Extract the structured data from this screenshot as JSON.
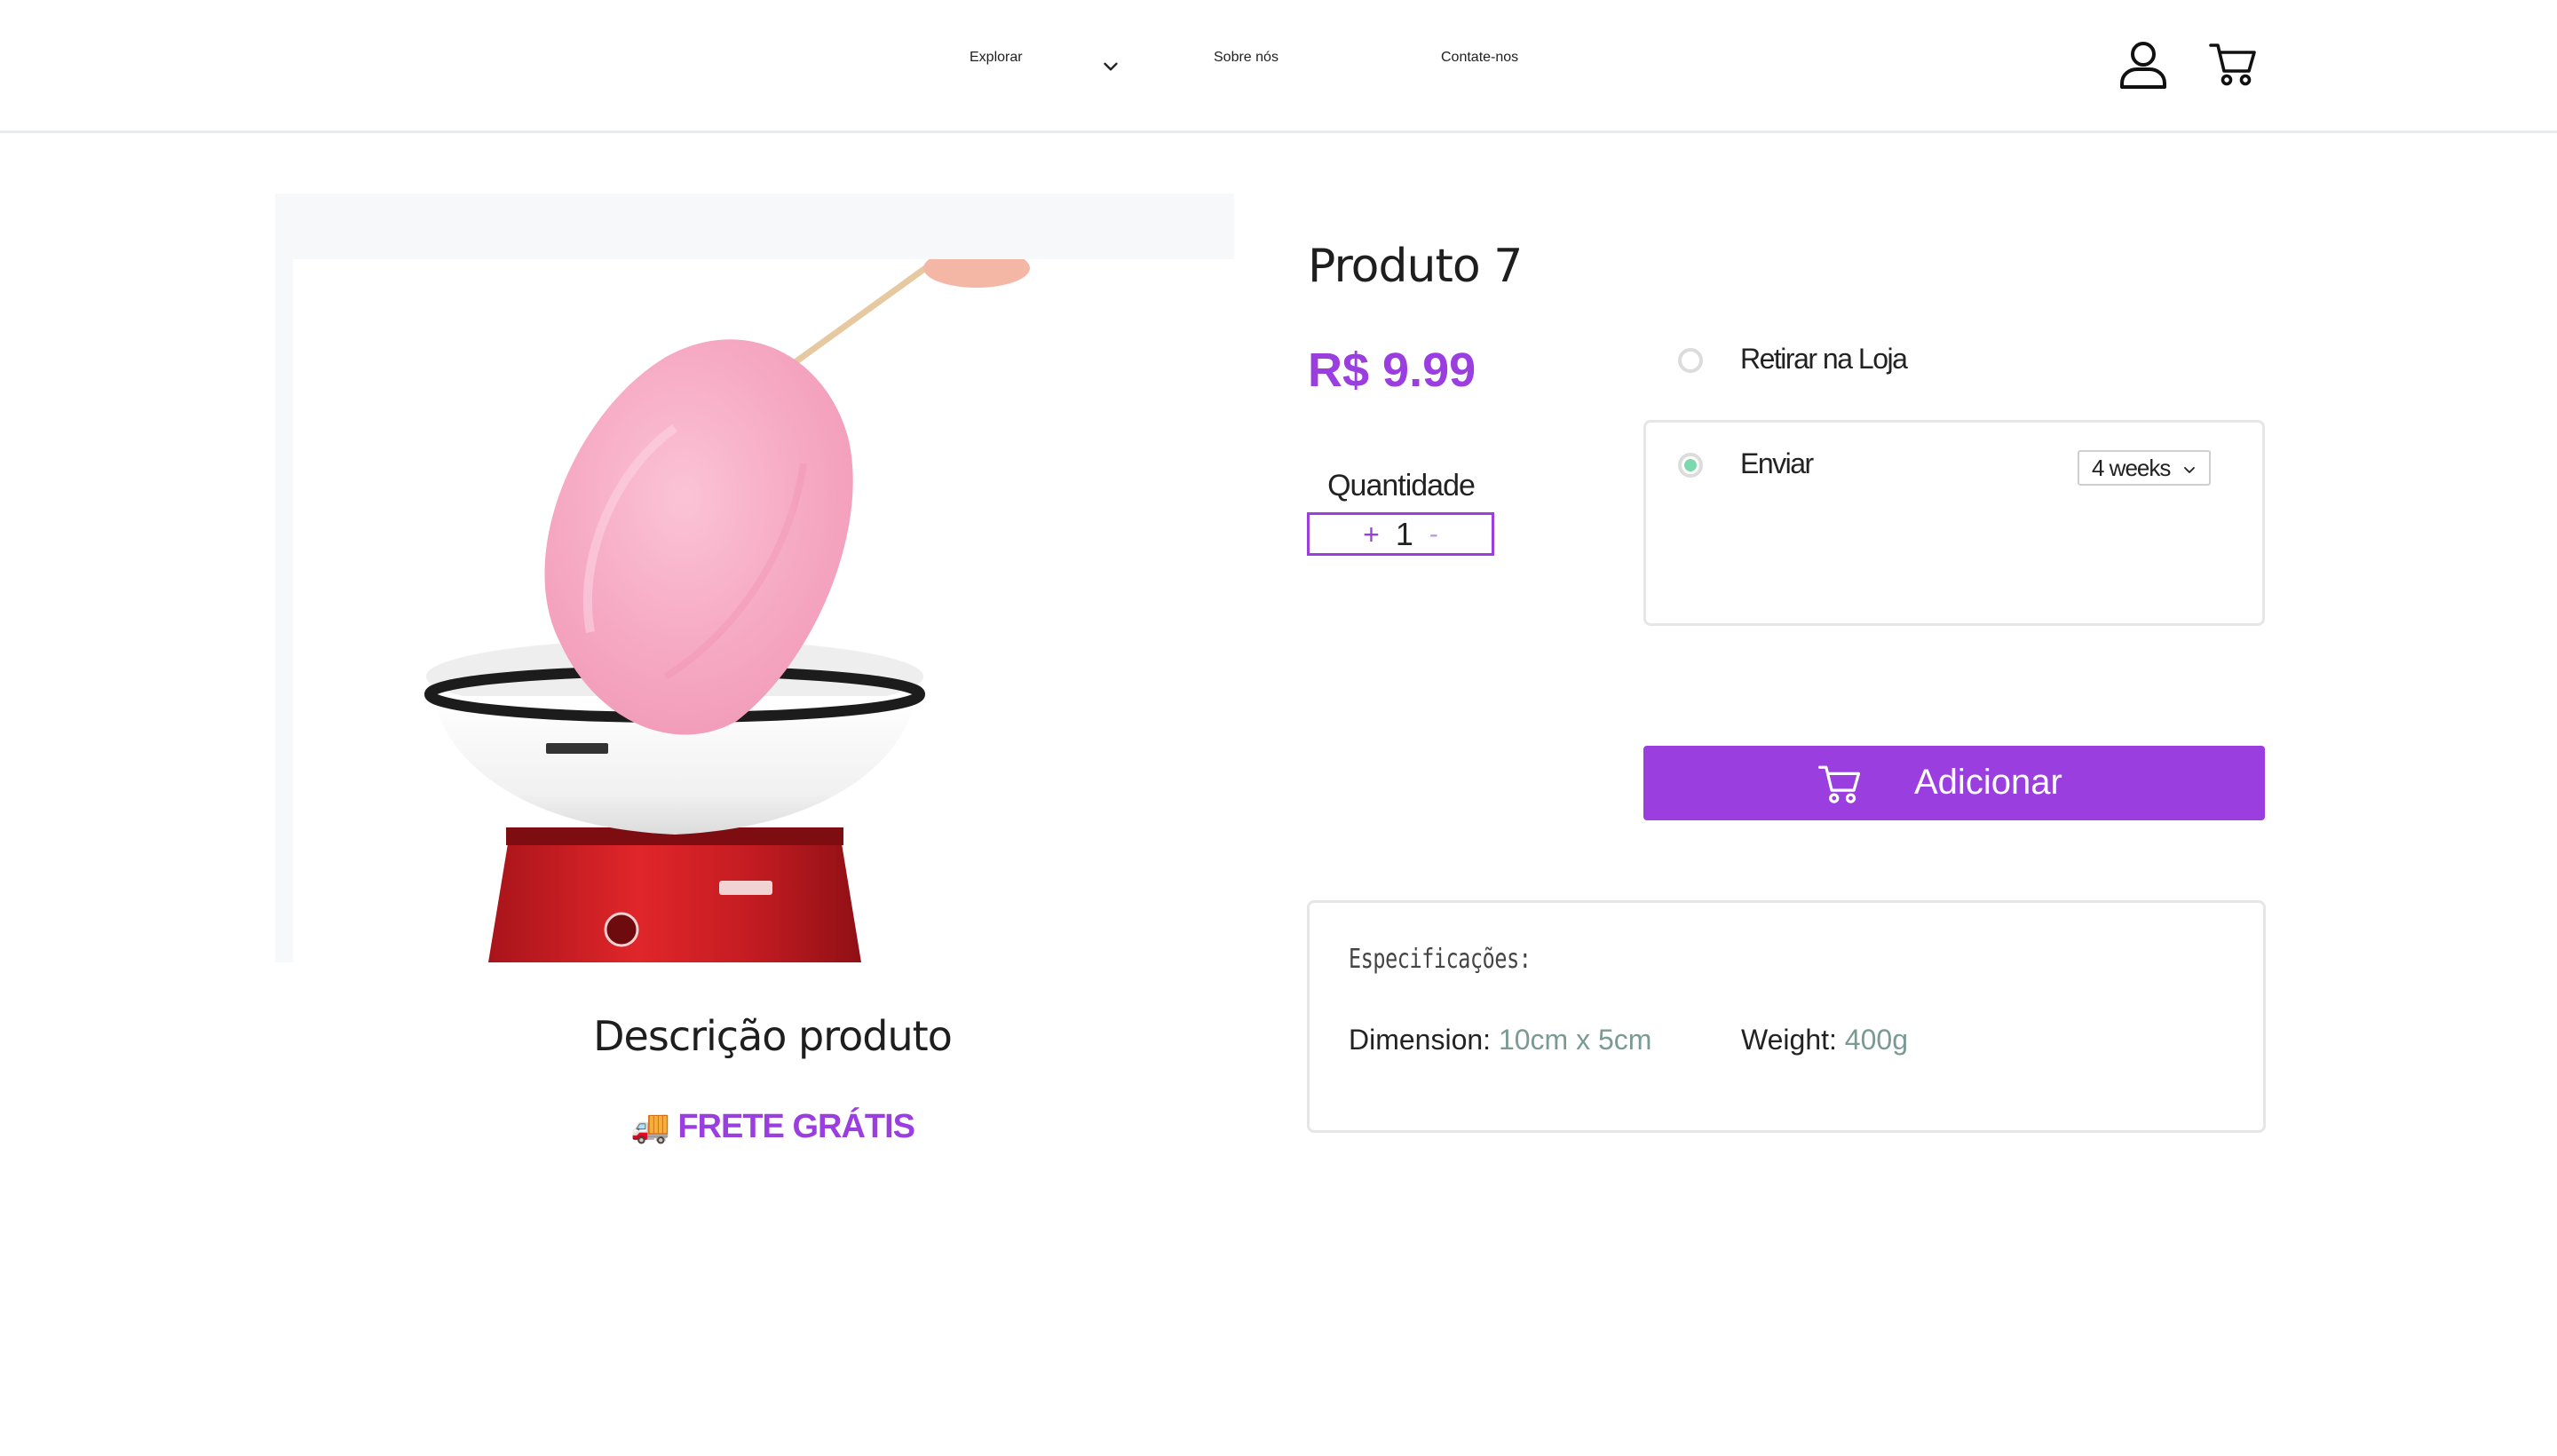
{
  "header": {
    "nav": {
      "explorar": "Explorar",
      "sobre": "Sobre nós",
      "contate": "Contate-nos"
    }
  },
  "product": {
    "title": "Produto 7",
    "price": "R$ 9.99",
    "quantity_label": "Quantidade",
    "quantity_plus": "+",
    "quantity_value": "1",
    "quantity_minus": "-",
    "description_title": "Descrição produto",
    "free_shipping_icon": "🚚",
    "free_shipping": "FRETE GRÁTIS"
  },
  "delivery": {
    "pickup_label": "Retirar na Loja",
    "ship_label": "Enviar",
    "frequency_selected": "4 weeks",
    "selected_option": "Enviar"
  },
  "actions": {
    "add_label": "Adicionar"
  },
  "specs": {
    "title": "Especificações:",
    "dimension_label": "Dimension:",
    "dimension_value": "10cm x 5cm",
    "weight_label": "Weight:",
    "weight_value": "400g"
  },
  "colors": {
    "accent": "#9a3ee0",
    "radio_checked": "#7bd9ad",
    "spec_value": "#7a9a94"
  }
}
